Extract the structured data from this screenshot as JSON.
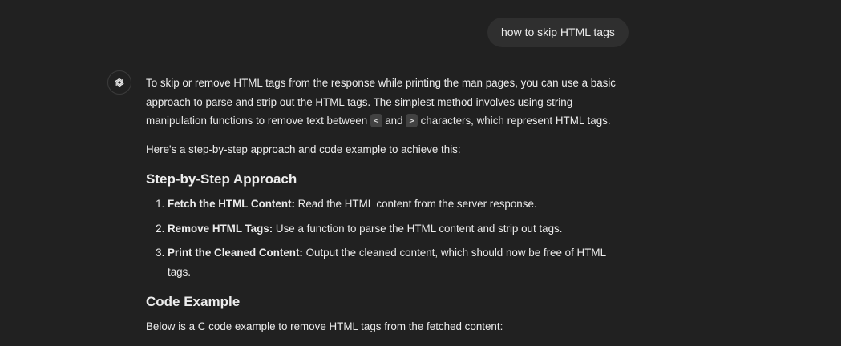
{
  "user_message": {
    "text": "how to skip HTML tags"
  },
  "assistant": {
    "avatar_icon": "openai-logo-icon",
    "intro": {
      "part1": "To skip or remove HTML tags from the response while printing the man pages, you can use a basic approach to parse and strip out the HTML tags. The simplest method involves using string manipulation functions to remove text between ",
      "code1": "<",
      "part2": " and ",
      "code2": ">",
      "part3": " characters, which represent HTML tags."
    },
    "lead": "Here's a step-by-step approach and code example to achieve this:",
    "heading_steps": "Step-by-Step Approach",
    "steps": [
      {
        "title": "Fetch the HTML Content:",
        "text": " Read the HTML content from the server response."
      },
      {
        "title": "Remove HTML Tags:",
        "text": " Use a function to parse the HTML content and strip out tags."
      },
      {
        "title": "Print the Cleaned Content:",
        "text": " Output the cleaned content, which should now be free of HTML tags."
      }
    ],
    "heading_code": "Code Example",
    "code_intro": "Below is a C code example to remove HTML tags from the fetched content:"
  },
  "colors": {
    "background": "#212121",
    "bubble": "#2f2f2f",
    "text": "#ececec",
    "inline_code_bg": "#424242"
  }
}
